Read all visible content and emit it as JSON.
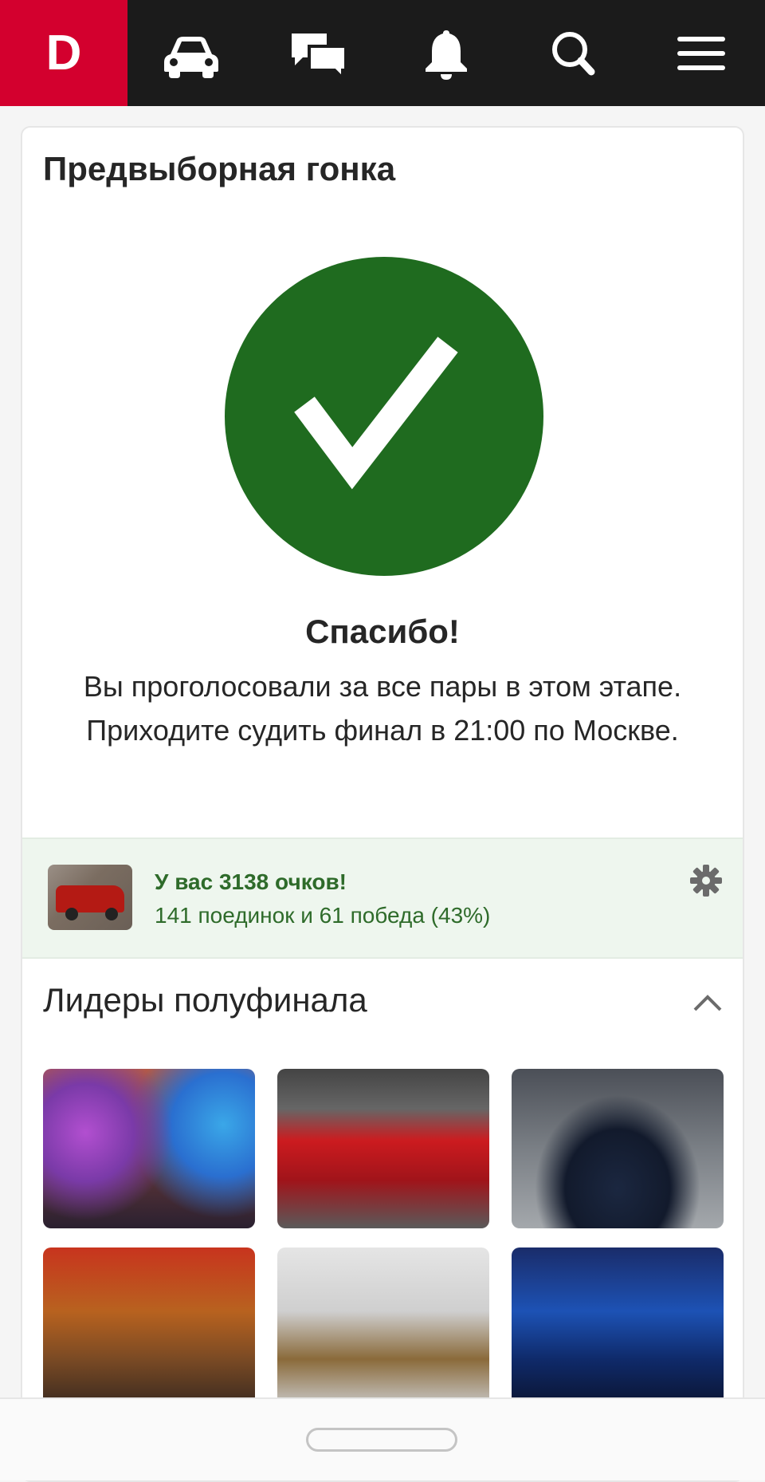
{
  "header": {
    "logo_text": "D",
    "accent_color": "#d3002e",
    "nav_icons": [
      "car-icon",
      "chat-icon",
      "bell-icon",
      "search-icon",
      "menu-icon"
    ]
  },
  "card": {
    "title": "Предвыборная гонка",
    "status_icon": "check-circle-icon",
    "status_color": "#1f6b1f",
    "thanks": "Спасибо!",
    "message_line1": "Вы проголосовали за все пары в этом этапе.",
    "message_line2": "Приходите судить финал в 21:00 по Москве."
  },
  "score": {
    "title": "У вас 3138 очков!",
    "subtitle": "141 поединок и 61 победа (43%)",
    "settings_icon": "gear-icon"
  },
  "leaders": {
    "title": "Лидеры полуфинала",
    "toggle_icon": "chevron-up-icon",
    "images": [
      "leader-photo-1",
      "leader-photo-2",
      "leader-photo-3",
      "leader-photo-4",
      "leader-photo-5",
      "leader-photo-6"
    ]
  }
}
